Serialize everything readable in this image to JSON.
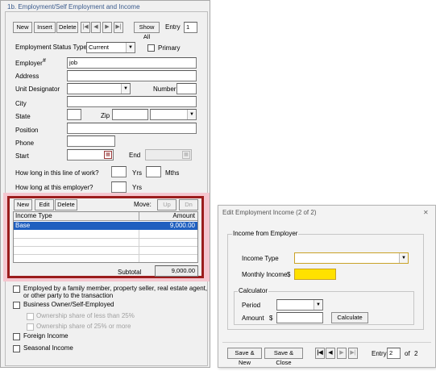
{
  "panel": {
    "title": "1b. Employment/Self Employment and Income",
    "toolbar": {
      "new": "New",
      "insert": "Insert",
      "delete": "Delete",
      "show_all": "Show All",
      "entry_label": "Entry",
      "entry_value": "1"
    },
    "status": {
      "label": "Employment Status Type",
      "value": "Current",
      "primary_label": "Primary"
    },
    "fields": {
      "employer_label": "Employer",
      "employer_hash": "#",
      "employer_value": "job",
      "address_label": "Address",
      "unit_label": "Unit Designator",
      "number_label": "Number",
      "city_label": "City",
      "state_label": "State",
      "zip_label": "Zip",
      "position_label": "Position",
      "phone_label": "Phone",
      "start_label": "Start",
      "end_label": "End",
      "line_of_work_label": "How long in this line of work?",
      "yrs_label": "Yrs",
      "mths_label": "Mths",
      "at_employer_label": "How long at this employer?",
      "yrs2_label": "Yrs"
    },
    "income": {
      "new": "New",
      "edit": "Edit",
      "delete": "Delete",
      "move_label": "Move:",
      "up": "Up",
      "dn": "Dn",
      "columns": [
        "Income Type",
        "Amount"
      ],
      "rows": [
        {
          "type": "Base",
          "amount": "9,000.00"
        }
      ],
      "subtotal_label": "Subtotal",
      "subtotal_value": "9,000.00",
      "highlight_color": "#9b1c1c"
    },
    "checks": {
      "family": "Employed by a family member, property seller, real estate agent,",
      "family2": "or other party to the transaction",
      "business": "Business Owner/Self-Employed",
      "share_less": "Ownership share of less than 25%",
      "share_more": "Ownership share of 25% or more",
      "foreign": "Foreign Income",
      "seasonal": "Seasonal Income"
    }
  },
  "dialog": {
    "title": "Edit Employment Income (2 of 2)",
    "close": "✕",
    "group1": "Income from Employer",
    "income_type_label": "Income Type",
    "monthly_label": "Monthly Income",
    "dollar": "$",
    "calculator": "Calculator",
    "period_label": "Period",
    "amount_label": "Amount",
    "dollar2": "$",
    "calculate": "Calculate",
    "save_new": "Save & New",
    "save_close": "Save & Close",
    "entry_label": "Entry",
    "entry_value": "2",
    "of_label": "of",
    "total": "2",
    "highlight": "#ffe100",
    "accent": "#c9a227"
  }
}
